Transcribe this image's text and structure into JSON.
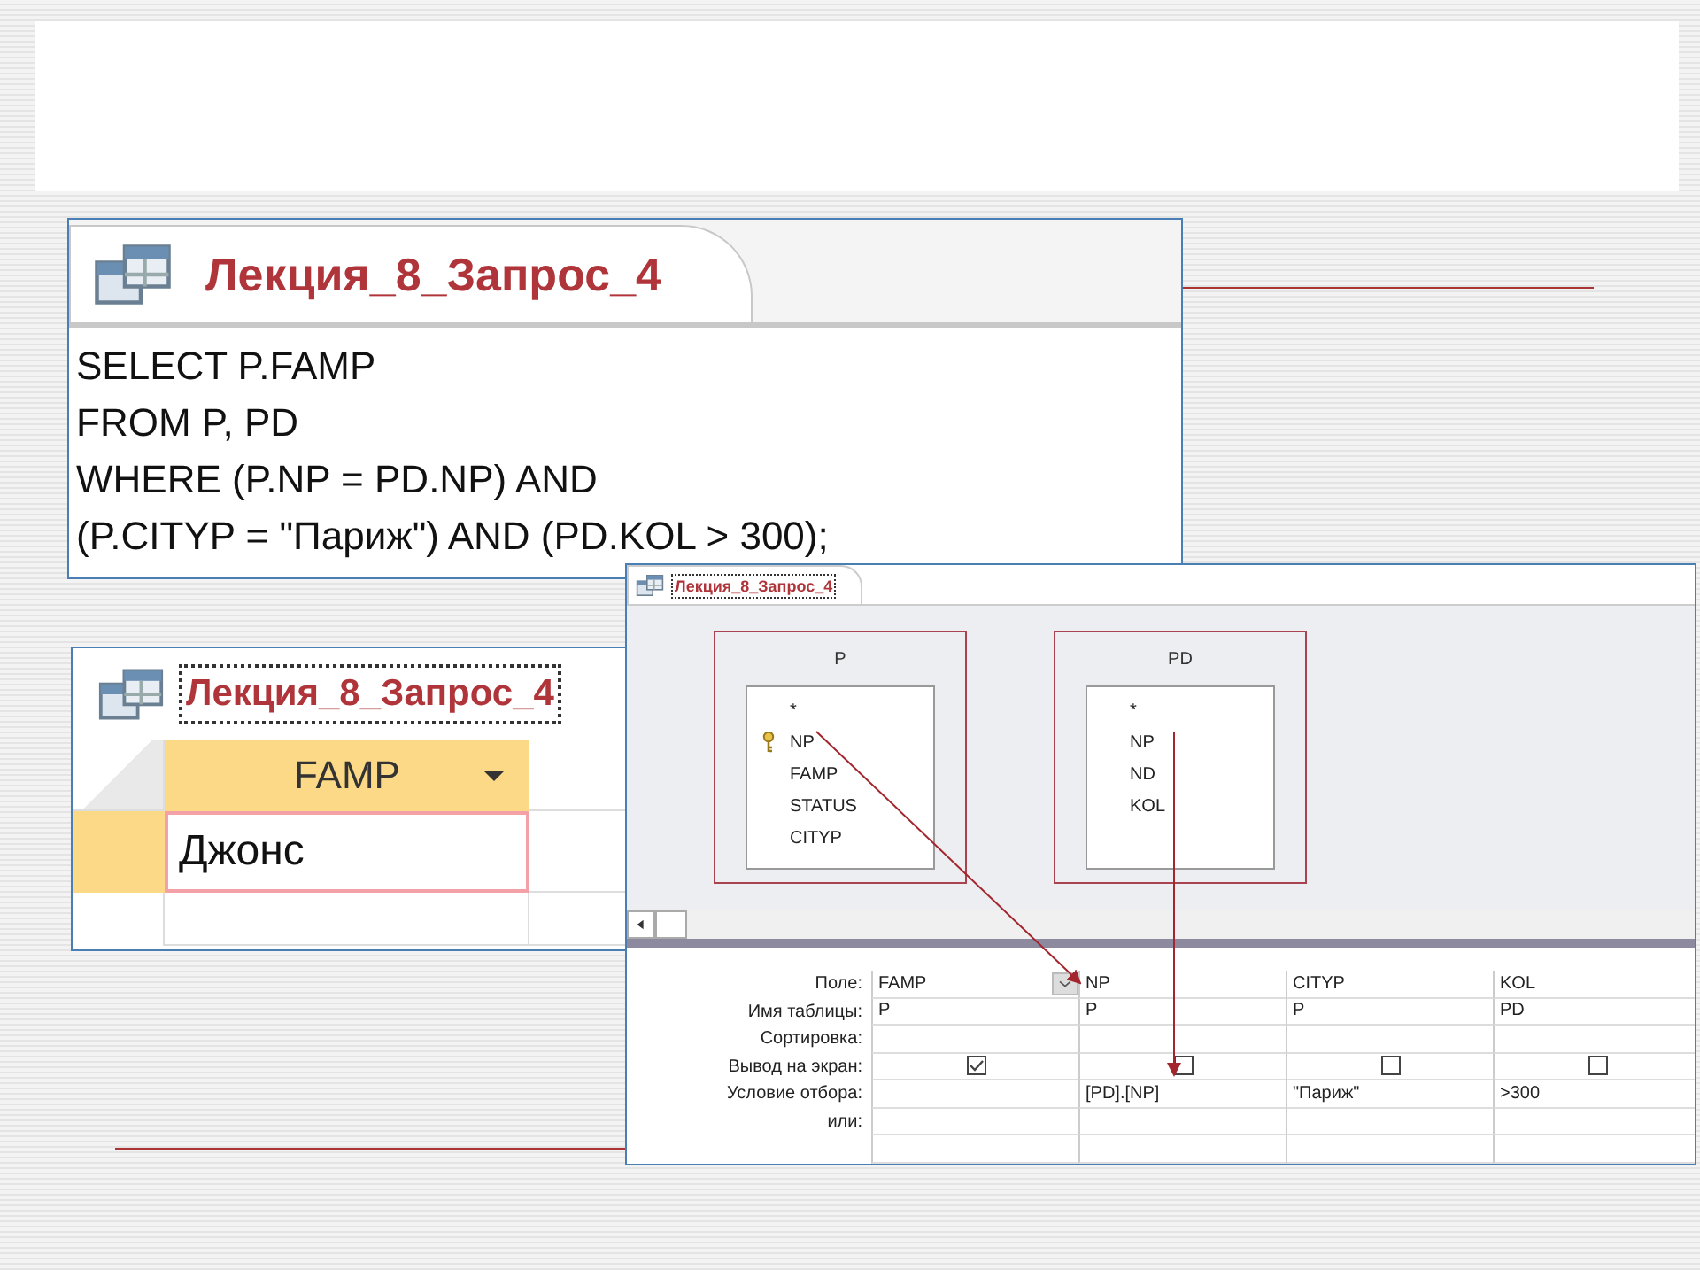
{
  "sql_window": {
    "tab_title": "Лекция_8_Запрос_4",
    "sql_lines": [
      "SELECT P.FAMP",
      "FROM P, PD",
      "WHERE (P.NP = PD.NP) AND",
      "(P.CITYP = \"Париж\") AND (PD.KOL > 300);"
    ]
  },
  "datasheet_window": {
    "tab_title": "Лекция_8_Запрос_4",
    "columns": [
      "FAMP"
    ],
    "rows": [
      [
        "Джонс"
      ]
    ]
  },
  "design_window": {
    "tab_title": "Лекция_8_Запрос_4",
    "tables": [
      {
        "name": "P",
        "fields": [
          {
            "name": "*",
            "primary_key": false
          },
          {
            "name": "NP",
            "primary_key": true
          },
          {
            "name": "FAMP",
            "primary_key": false
          },
          {
            "name": "STATUS",
            "primary_key": false
          },
          {
            "name": "CITYP",
            "primary_key": false
          }
        ]
      },
      {
        "name": "PD",
        "fields": [
          {
            "name": "*",
            "primary_key": false
          },
          {
            "name": "NP",
            "primary_key": false
          },
          {
            "name": "ND",
            "primary_key": false
          },
          {
            "name": "KOL",
            "primary_key": false
          }
        ]
      }
    ],
    "grid": {
      "row_labels": [
        "Поле:",
        "Имя таблицы:",
        "Сортировка:",
        "Вывод на экран:",
        "Условие отбора:",
        "или:"
      ],
      "columns": [
        {
          "field": "FAMP",
          "table": "P",
          "show": true,
          "selected": true
        },
        {
          "field": "NP",
          "table": "P",
          "show": false,
          "criteria": "[PD].[NP]",
          "selected": false
        },
        {
          "field": "CITYP",
          "table": "P",
          "show": false,
          "criteria": "\"Париж\"",
          "selected": false
        },
        {
          "field": "KOL",
          "table": "PD",
          "show": false,
          "criteria": ">300",
          "selected": false
        }
      ]
    }
  }
}
